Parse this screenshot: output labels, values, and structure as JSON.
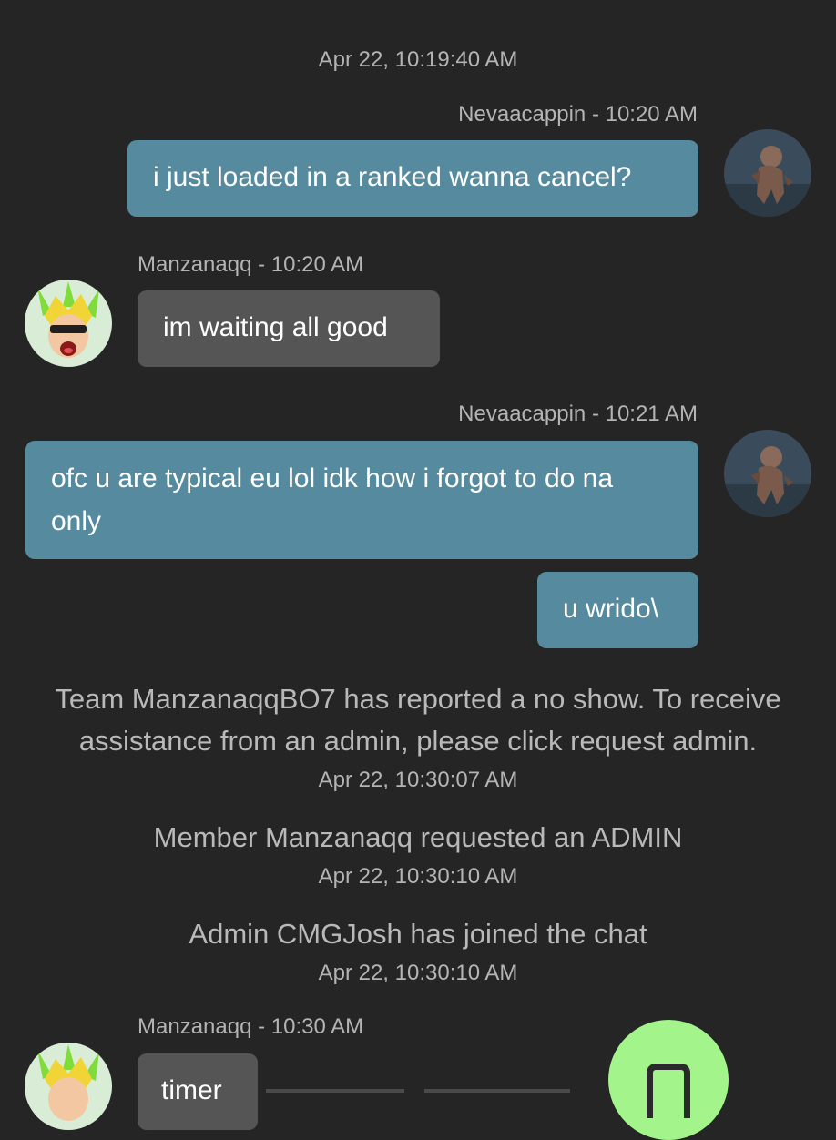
{
  "colors": {
    "background": "#252525",
    "my_bubble": "#568a9e",
    "their_bubble": "#555555",
    "fab": "#a3f58b"
  },
  "top_timestamp": "Apr 22, 10:19:40 AM",
  "messages": [
    {
      "sender": "Nevaacappin - 10:20 AM",
      "text": "i just loaded in a ranked wanna cancel?",
      "side": "right"
    },
    {
      "sender": "Manzanaqq - 10:20 AM",
      "text": "im waiting all good",
      "side": "left"
    },
    {
      "sender": "Nevaacappin - 10:21 AM",
      "text": "ofc u are typical eu lol idk how i forgot to do na only",
      "text_line2": "only",
      "text_line1": "ofc u are typical eu lol idk how i forgot to do na",
      "side": "right"
    },
    {
      "text": "u wrido\\",
      "side": "right"
    }
  ],
  "system": [
    {
      "text_line1": "Team ManzanaqqBO7 has reported a no show. To receive",
      "text_line2": "assistance from an admin, please click request admin.",
      "time": "Apr 22, 10:30:07 AM"
    },
    {
      "text": "Member Manzanaqq requested an ADMIN",
      "time": "Apr 22, 10:30:10 AM"
    },
    {
      "text": "Admin CMGJosh has joined the chat",
      "time": "Apr 22, 10:30:10 AM"
    }
  ],
  "last_message": {
    "sender": "Manzanaqq - 10:30 AM",
    "text": "timer"
  },
  "fab": {
    "icon": "door-icon"
  }
}
